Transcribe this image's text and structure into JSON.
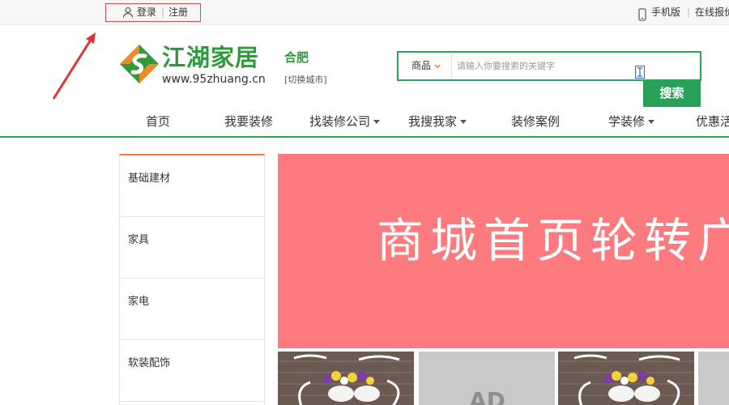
{
  "topbar": {
    "login_label": "登录",
    "separator": "|",
    "register_label": "注册",
    "mobile_label": "手机版",
    "quote_label": "在线报价"
  },
  "header": {
    "logo_name": "江湖家居",
    "logo_url": "www.95zhuang.cn",
    "city": "合肥",
    "switch_city": "[切换城市]"
  },
  "search": {
    "scope": "商品",
    "placeholder": "请输入你要搜索的关键字",
    "button_label": "搜索"
  },
  "nav": {
    "items": [
      {
        "label": "首页"
      },
      {
        "label": "我要装修"
      },
      {
        "label": "找装修公司"
      },
      {
        "label": "我搜我家"
      },
      {
        "label": "装修案例"
      },
      {
        "label": "学装修"
      },
      {
        "label": "优惠活动"
      }
    ]
  },
  "categories": [
    {
      "label": "基础建材"
    },
    {
      "label": "家具"
    },
    {
      "label": "家电"
    },
    {
      "label": "软装配饰"
    }
  ],
  "banner": {
    "text": "商城首页轮转广告"
  },
  "thumbs": {
    "placeholder_text": "AD"
  },
  "colors": {
    "brand_green": "#2aa55a",
    "accent_orange": "#f07a3a",
    "banner_pink": "#fd7b7e",
    "highlight_red": "#e8454a"
  }
}
